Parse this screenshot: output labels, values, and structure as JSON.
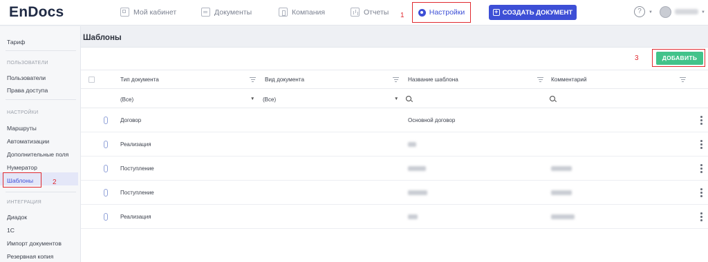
{
  "app": {
    "logo": "EnDocs"
  },
  "nav": {
    "items": [
      {
        "label": "Мой кабинет",
        "icon": "grid-icon"
      },
      {
        "label": "Документы",
        "icon": "document-icon"
      },
      {
        "label": "Компания",
        "icon": "building-icon"
      },
      {
        "label": "Отчеты",
        "icon": "chart-icon"
      }
    ],
    "settings": {
      "label": "Настройки",
      "icon": "gear-icon"
    },
    "create_button": "СОЗДАТЬ ДОКУМЕНТ",
    "help_symbol": "?"
  },
  "annotations": {
    "one": "1",
    "two": "2",
    "three": "3"
  },
  "sidebar": {
    "tariff": "Тариф",
    "sections": {
      "users": "ПОЛЬЗОВАТЕЛИ",
      "settings": "НАСТРОЙКИ",
      "integration": "ИНТЕГРАЦИЯ"
    },
    "users_items": [
      "Пользователи",
      "Права доступа"
    ],
    "settings_items": [
      "Маршруты",
      "Автоматизации",
      "Дополнительные поля",
      "Нумератор",
      "Шаблоны"
    ],
    "integration_items": [
      "Диадок",
      "1С",
      "Импорт документов",
      "Резервная копия"
    ],
    "active": "Шаблоны"
  },
  "page": {
    "title": "Шаблоны",
    "add_button": "ДОБАВИТЬ"
  },
  "table": {
    "columns": [
      "Тип документа",
      "Вид документа",
      "Название шаблона",
      "Комментарий"
    ],
    "filters": {
      "type": "(Все)",
      "kind": "(Все)"
    },
    "rows": [
      {
        "type": "Договор",
        "name": "Основной договор"
      },
      {
        "type": "Реализация",
        "name": ""
      },
      {
        "type": "Поступление",
        "name": ""
      },
      {
        "type": "Поступление",
        "name": ""
      },
      {
        "type": "Реализация",
        "name": ""
      }
    ]
  },
  "colors": {
    "accent": "#3d4fd6",
    "add_green": "#42c38a",
    "annotation_red": "#e0282e"
  }
}
